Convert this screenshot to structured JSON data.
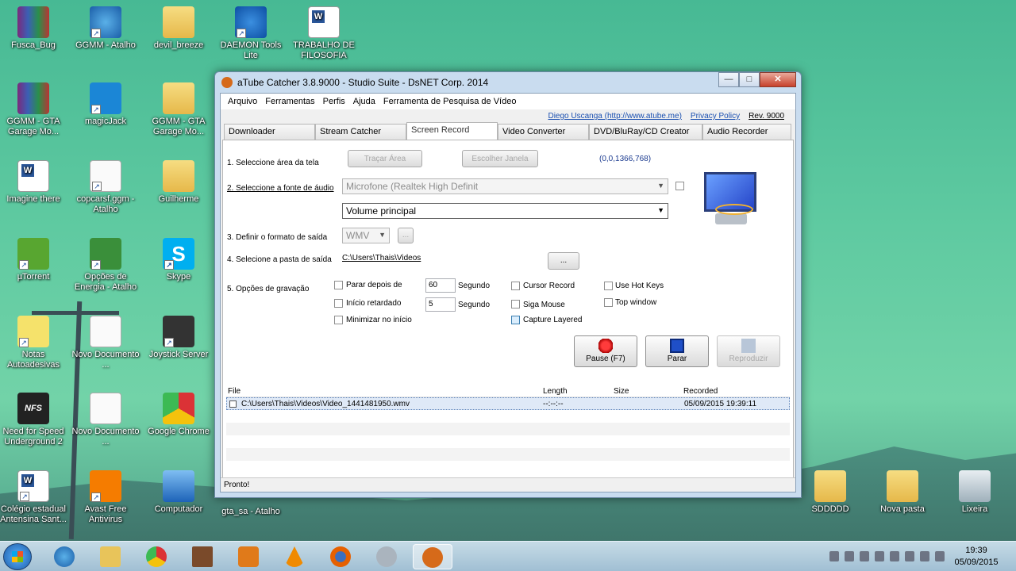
{
  "desktop": {
    "icons": [
      {
        "label": "Fusca_Bug"
      },
      {
        "label": "GGMM - Atalho"
      },
      {
        "label": "devil_breeze"
      },
      {
        "label": "DAEMON Tools Lite"
      },
      {
        "label": "TRABALHO DE FILOSOFIA"
      },
      {
        "label": "GGMM - GTA Garage Mo..."
      },
      {
        "label": "magicJack"
      },
      {
        "label": "GGMM - GTA Garage Mo..."
      },
      {
        "label": "Imagine there"
      },
      {
        "label": "copcarsf.ggm - Atalho"
      },
      {
        "label": "Guilherme"
      },
      {
        "label": "µTorrent"
      },
      {
        "label": "Opções de Energia - Atalho"
      },
      {
        "label": "Skype"
      },
      {
        "label": "Notas Autoadesivas"
      },
      {
        "label": "Novo Documento ..."
      },
      {
        "label": "Joystick Server"
      },
      {
        "label": "Need for Speed Underground 2"
      },
      {
        "label": "Novo Documento ..."
      },
      {
        "label": "Google Chrome"
      },
      {
        "label": "Colégio estadual Antensina Sant..."
      },
      {
        "label": "Avast Free Antivirus"
      },
      {
        "label": "Computador"
      },
      {
        "label": "gta_sa - Atalho"
      },
      {
        "label": "SDDDDD"
      },
      {
        "label": "Nova pasta"
      },
      {
        "label": "Lixeira"
      }
    ]
  },
  "window": {
    "title": "aTube Catcher 3.8.9000 - Studio Suite - DsNET Corp. 2014",
    "controls": {
      "minimize": "—",
      "maximize": "□",
      "close": "✕"
    },
    "menu": [
      "Arquivo",
      "Ferramentas",
      "Perfis",
      "Ajuda",
      "Ferramenta de Pesquisa de Vídeo"
    ],
    "links": {
      "author": "Diego Uscanga (http://www.atube.me)",
      "privacy": "Privacy Policy",
      "rev": "Rev. 9000"
    },
    "tabs": [
      "Downloader",
      "Stream Catcher",
      "Screen Record",
      "Video Converter",
      "DVD/BluRay/CD Creator",
      "Audio Recorder"
    ],
    "active_tab": "Screen Record"
  },
  "record": {
    "step1_label": "1. Seleccione área da tela",
    "trace_area_btn": "Traçar Área",
    "choose_window_btn": "Escolher Janela",
    "coords": "(0,0,1366,768)",
    "step2_label": "2. Seleccione a fonte de áudio",
    "audio_source": "Microfone (Realtek High Definit",
    "audio_channel": "Volume principal",
    "step3_label": "3. Definir o formato de saída",
    "format": "WMV",
    "format_more_btn": "...",
    "step4_label": "4. Selecione a pasta de saída",
    "output_path": "C:\\Users\\Thais\\Videos",
    "browse_btn": "...",
    "step5_label": "5. Opções de gravação",
    "opt_stop_after": "Parar depois de",
    "stop_after_value": "60",
    "stop_after_unit": "Segundo",
    "opt_delay": "Início retardado",
    "delay_value": "5",
    "delay_unit": "Segundo",
    "opt_minimize": "Minimizar no início",
    "opt_cursor": "Cursor Record",
    "opt_follow_mouse": "Siga Mouse",
    "opt_capture_layered": "Capture Layered",
    "opt_hotkeys": "Use Hot Keys",
    "opt_top_window": "Top window",
    "pause_btn": "Pause (F7)",
    "stop_btn": "Parar",
    "play_btn": "Reproduzir"
  },
  "files": {
    "headers": {
      "file": "File",
      "length": "Length",
      "size": "Size",
      "recorded": "Recorded"
    },
    "rows": [
      {
        "file": "C:\\Users\\Thais\\Videos\\Video_1441481950.wmv",
        "length": "--:--:--",
        "size": "",
        "recorded": "05/09/2015 19:39:11"
      }
    ]
  },
  "status": "Pronto!",
  "taskbar": {
    "clock_time": "19:39",
    "clock_date": "05/09/2015"
  }
}
